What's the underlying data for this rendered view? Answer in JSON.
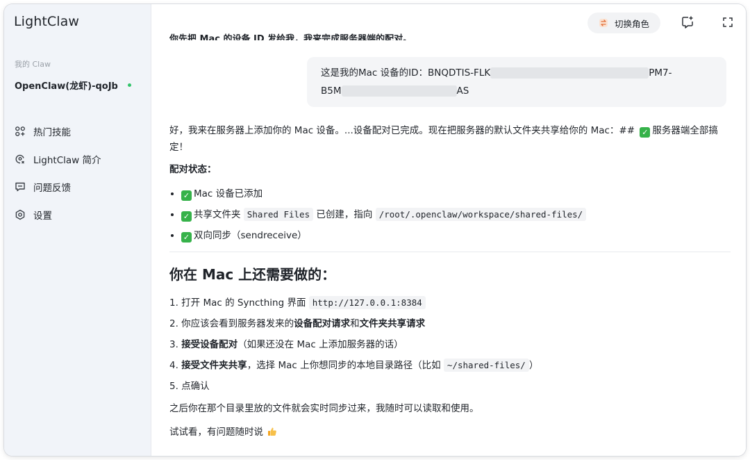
{
  "app": {
    "name": "LightClaw"
  },
  "sidebar": {
    "section_label": "我的 Claw",
    "claw_name": "OpenClaw(龙虾)-qoJb",
    "items": [
      {
        "label": "热门技能",
        "icon": "skills-grid-icon"
      },
      {
        "label": "LightClaw 简介",
        "icon": "intro-icon"
      },
      {
        "label": "问题反馈",
        "icon": "feedback-icon"
      },
      {
        "label": "设置",
        "icon": "settings-icon"
      }
    ]
  },
  "topbar": {
    "switch_role_label": "切换角色",
    "new_chat_icon": "new-chat-icon",
    "expand_icon": "expand-icon"
  },
  "chat": {
    "cut_off_line": "你先把 Mac 的设备 ID 发给我，我来完成服务器端的配对。",
    "user_message": {
      "line1_prefix": "这是我的Mac 设备的ID：BNQDTIS-FLK",
      "line1_suffix": "PM7-",
      "line2_prefix": "B5M",
      "line2_suffix": "AS"
    },
    "reply": {
      "intro": "好，我来在服务器上添加你的 Mac 设备。...设备配对已完成。现在把服务器的默认文件夹共享给你的 Mac：##",
      "intro_tail": "服务器端全部搞定！",
      "status_title": "配对状态：",
      "status_items": {
        "item1": "Mac 设备已添加",
        "item2_pre": "共享文件夹",
        "item2_code1": "Shared Files",
        "item2_mid": "已创建，指向",
        "item2_code2": "/root/.openclaw/workspace/shared-files/",
        "item3": "双向同步（sendreceive）"
      },
      "heading": "你在 Mac 上还需要做的：",
      "steps": {
        "s1_pre": "1. 打开 Mac 的 Syncthing 界面",
        "s1_code": "http://127.0.0.1:8384",
        "s2_pre": "2. 你应该会看到服务器发来的",
        "s2_b1": "设备配对请求",
        "s2_mid": "和",
        "s2_b2": "文件夹共享请求",
        "s3_num": "3.",
        "s3_b": "接受设备配对",
        "s3_rest": "（如果还没在 Mac 上添加服务器的话）",
        "s4_num": "4.",
        "s4_b": "接受文件夹共享",
        "s4_rest": "，选择 Mac 上你想同步的本地目录路径（比如",
        "s4_code": "~/shared-files/",
        "s4_end": "）",
        "s5": "5. 点确认"
      },
      "after": "之后你在那个目录里放的文件就会实时同步过来，我随时可以读取和使用。",
      "closing": "试试看，有问题随时说"
    }
  },
  "colors": {
    "sidebar_bg": "#f1f4f9",
    "online": "#32c46a",
    "check": "#36b24a"
  }
}
